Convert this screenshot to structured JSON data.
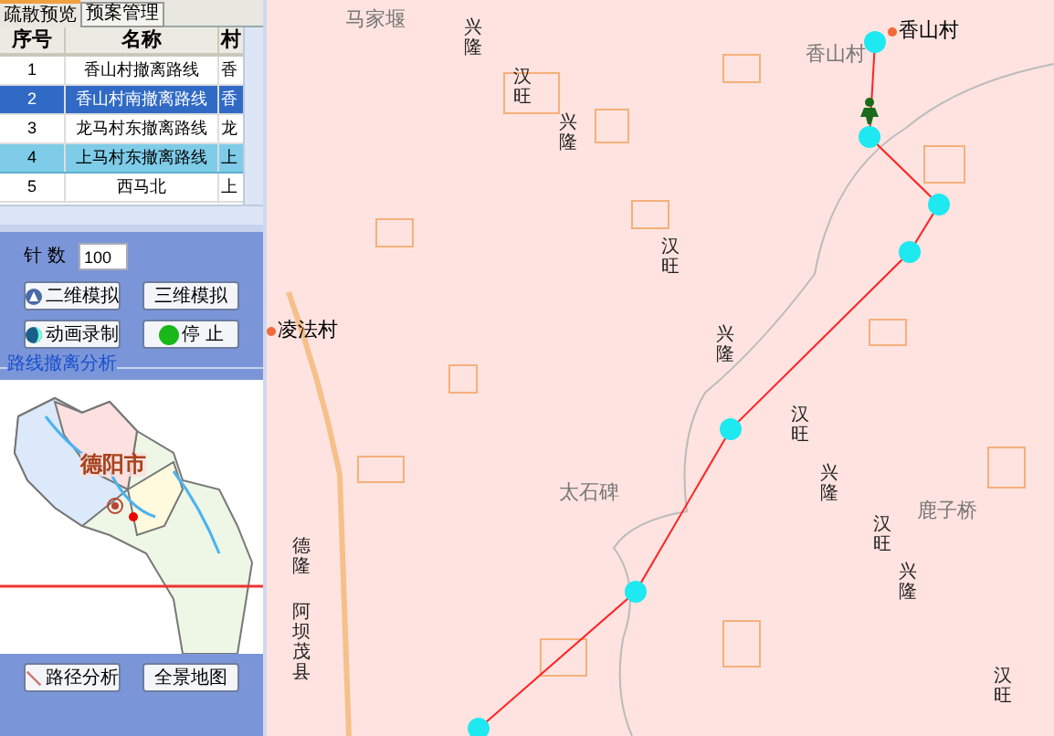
{
  "tabs": [
    {
      "label": "疏散预览",
      "selected": true
    },
    {
      "label": "预案管理",
      "selected": false
    }
  ],
  "table": {
    "columns": [
      "序号",
      "名称",
      "村"
    ],
    "rows": [
      {
        "cells": [
          "1",
          "香山村撤离路线",
          "香"
        ],
        "selected": false,
        "shaded": false
      },
      {
        "cells": [
          "2",
          "香山村南撤离路线",
          "香"
        ],
        "selected": true,
        "shaded": false
      },
      {
        "cells": [
          "3",
          "龙马村东撤离路线",
          "龙"
        ],
        "selected": false,
        "shaded": false
      },
      {
        "cells": [
          "4",
          "上马村东撤离路线",
          "上"
        ],
        "selected": false,
        "shaded": true
      },
      {
        "cells": [
          "5",
          "西马北",
          "上"
        ],
        "selected": false,
        "shaded": false
      }
    ]
  },
  "needle_count": {
    "label": "针 数",
    "value": "100"
  },
  "buttons": [
    {
      "label": "二维模拟",
      "kind": "sim"
    },
    {
      "label": "三维模拟",
      "kind": "plain"
    },
    {
      "label": "动画录制",
      "kind": "record"
    },
    {
      "label": "停 止",
      "kind": "stop"
    }
  ],
  "group_title": "路线撤离分析",
  "overview_map": {
    "label": "德阳市"
  },
  "bottom_buttons": [
    {
      "label": "路径分析",
      "kind": "path"
    },
    {
      "label": "全景地图",
      "kind": "plain"
    }
  ],
  "map_labels": [
    {
      "text": "马家堰",
      "kind": "area"
    },
    {
      "text": "香山村",
      "kind": "village"
    },
    {
      "text": "香山村",
      "kind": "area"
    },
    {
      "text": "凌法村",
      "kind": "village"
    },
    {
      "text": "太石碑",
      "kind": "area"
    },
    {
      "text": "鹿子桥",
      "kind": "area"
    },
    {
      "text": "兴隆",
      "kind": "road"
    },
    {
      "text": "汉旺",
      "kind": "road"
    },
    {
      "text": "兴隆",
      "kind": "road"
    },
    {
      "text": "汉旺",
      "kind": "road"
    },
    {
      "text": "兴隆",
      "kind": "road"
    },
    {
      "text": "汉旺",
      "kind": "road"
    },
    {
      "text": "兴隆",
      "kind": "road"
    },
    {
      "text": "汉旺",
      "kind": "road"
    },
    {
      "text": "兴隆",
      "kind": "road"
    },
    {
      "text": "汉旺",
      "kind": "road"
    },
    {
      "text": "德隆",
      "kind": "road"
    },
    {
      "text": "阿坝茂县",
      "kind": "road"
    }
  ]
}
